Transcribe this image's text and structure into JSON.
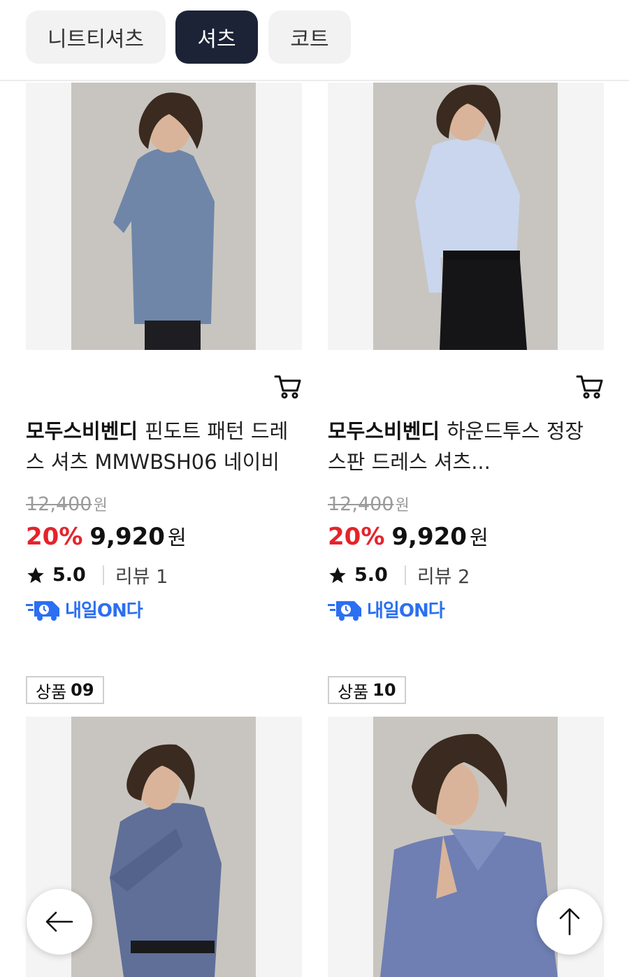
{
  "tabs": [
    {
      "label": "니트티셔츠",
      "active": false
    },
    {
      "label": "셔츠",
      "active": true
    },
    {
      "label": "코트",
      "active": false
    }
  ],
  "products": [
    {
      "brand": "모두스비벤디",
      "name": "핀도트 패턴 드레스 셔츠 MMWBSH06 네이비",
      "original_price": "12,400",
      "original_unit": "원",
      "discount": "20%",
      "price": "9,920",
      "unit": "원",
      "rating": "5.0",
      "reviews": "리뷰 1",
      "delivery": "내일ON다",
      "shirt_color": "#6f86a8"
    },
    {
      "brand": "모두스비벤디",
      "name": "하운드투스 정장 스판 드레스 셔츠...",
      "original_price": "12,400",
      "original_unit": "원",
      "discount": "20%",
      "price": "9,920",
      "unit": "원",
      "rating": "5.0",
      "reviews": "리뷰 2",
      "delivery": "내일ON다",
      "shirt_color": "#c9d6ee"
    }
  ],
  "next_items": [
    {
      "badge_label": "상품",
      "badge_num": "09",
      "shirt_color": "#5f6f98"
    },
    {
      "badge_label": "상품",
      "badge_num": "10",
      "shirt_color": "#6f7fb3"
    }
  ],
  "colors": {
    "accent_dark": "#1c2336",
    "discount_red": "#e5232b",
    "delivery_blue": "#2b6ff2"
  },
  "icons": {
    "cart": "cart-icon",
    "star": "star-icon",
    "back": "arrow-left-icon",
    "top": "arrow-up-icon",
    "delivery": "delivery-truck-icon"
  }
}
